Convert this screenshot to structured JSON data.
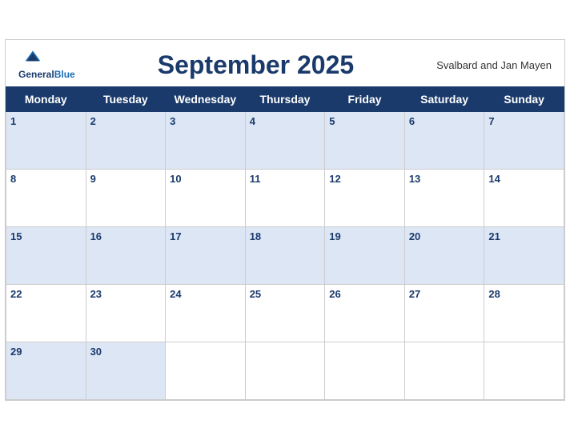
{
  "header": {
    "logo_general": "General",
    "logo_blue": "Blue",
    "month_title": "September 2025",
    "region": "Svalbard and Jan Mayen"
  },
  "days_of_week": [
    "Monday",
    "Tuesday",
    "Wednesday",
    "Thursday",
    "Friday",
    "Saturday",
    "Sunday"
  ],
  "weeks": [
    [
      1,
      2,
      3,
      4,
      5,
      6,
      7
    ],
    [
      8,
      9,
      10,
      11,
      12,
      13,
      14
    ],
    [
      15,
      16,
      17,
      18,
      19,
      20,
      21
    ],
    [
      22,
      23,
      24,
      25,
      26,
      27,
      28
    ],
    [
      29,
      30,
      null,
      null,
      null,
      null,
      null
    ]
  ]
}
